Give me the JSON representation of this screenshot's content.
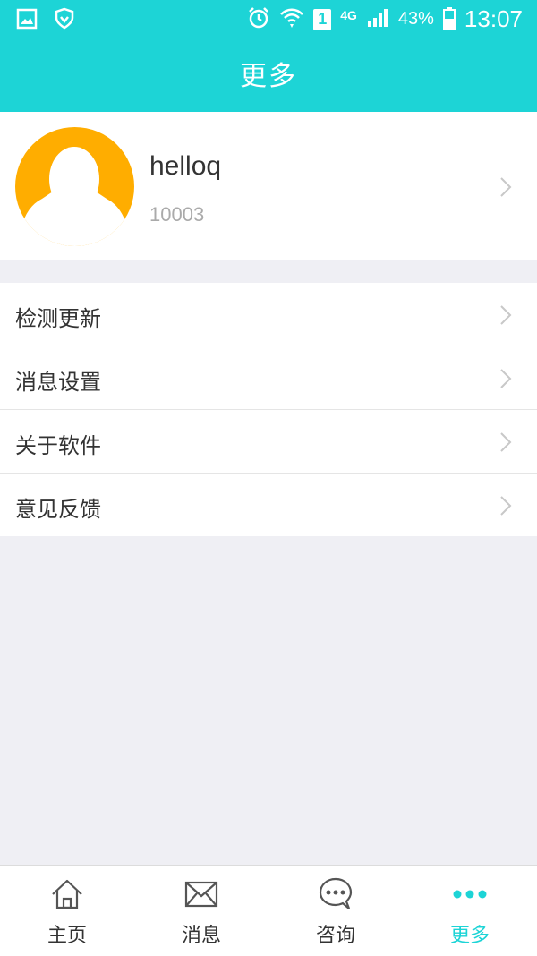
{
  "status_bar": {
    "time": "13:07",
    "battery": "43%",
    "network": "4G",
    "sim": "1"
  },
  "header": {
    "title": "更多"
  },
  "profile": {
    "name": "helloq",
    "id": "10003"
  },
  "menu": [
    {
      "label": "检测更新"
    },
    {
      "label": "消息设置"
    },
    {
      "label": "关于软件"
    },
    {
      "label": "意见反馈"
    }
  ],
  "tabs": [
    {
      "label": "主页",
      "icon": "home-icon"
    },
    {
      "label": "消息",
      "icon": "mail-icon"
    },
    {
      "label": "咨询",
      "icon": "chat-icon"
    },
    {
      "label": "更多",
      "icon": "more-icon",
      "active": true
    }
  ],
  "colors": {
    "accent": "#1dd4d6",
    "avatar_bg": "#ffad00",
    "background": "#efeff4"
  }
}
